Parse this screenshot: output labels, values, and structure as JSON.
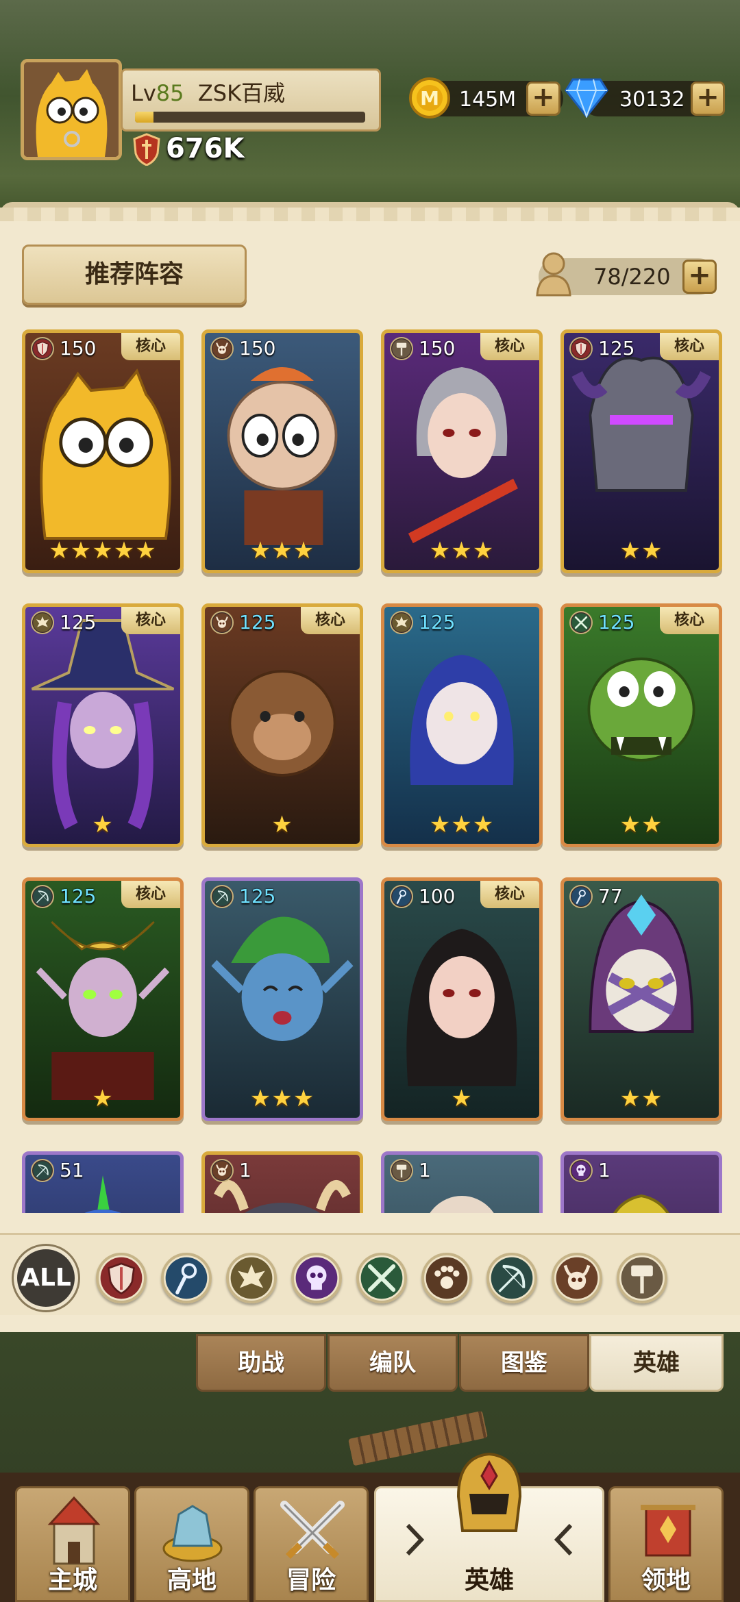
{
  "player": {
    "level_prefix": "Lv",
    "level": "85",
    "name": "ZSK百威",
    "power": "676K",
    "xp_fraction": 0.08
  },
  "resources": {
    "gold": "145M",
    "gems": "30132",
    "plus": "+"
  },
  "panel": {
    "recommend_label": "推荐阵容",
    "capacity": "78/220",
    "plus": "+"
  },
  "core_label": "核心",
  "heroes": [
    {
      "level": "150",
      "class_icon": "shield-icon",
      "core": true,
      "stars": "★★★★★",
      "rarity": "gold",
      "blue": false,
      "art": "yellow-creature"
    },
    {
      "level": "150",
      "class_icon": "horned-skull-icon",
      "core": false,
      "stars": "★★★",
      "rarity": "gold",
      "blue": false,
      "art": "pig-hero"
    },
    {
      "level": "150",
      "class_icon": "hammer-icon",
      "core": true,
      "stars": "★★★",
      "rarity": "gold",
      "blue": false,
      "art": "silver-hair-warrior"
    },
    {
      "level": "125",
      "class_icon": "shield-icon",
      "core": true,
      "stars": "★★",
      "rarity": "gold",
      "blue": false,
      "art": "dark-knight"
    },
    {
      "level": "125",
      "class_icon": "phoenix-icon",
      "core": true,
      "stars": "★",
      "rarity": "gold",
      "blue": false,
      "art": "witch"
    },
    {
      "level": "125",
      "class_icon": "horned-skull-icon",
      "core": true,
      "stars": "★",
      "rarity": "gold",
      "blue": true,
      "art": "monkey-king"
    },
    {
      "level": "125",
      "class_icon": "phoenix-icon",
      "core": false,
      "stars": "★★★",
      "rarity": "orange",
      "blue": true,
      "art": "blue-hair-girl"
    },
    {
      "level": "125",
      "class_icon": "crossed-swords-icon",
      "core": true,
      "stars": "★★",
      "rarity": "orange",
      "blue": true,
      "art": "green-orc"
    },
    {
      "level": "125",
      "class_icon": "bow-icon",
      "core": true,
      "stars": "★",
      "rarity": "orange",
      "blue": true,
      "art": "elf-queen"
    },
    {
      "level": "125",
      "class_icon": "bow-icon",
      "core": false,
      "stars": "★★★",
      "rarity": "purple",
      "blue": true,
      "art": "blue-goblin"
    },
    {
      "level": "100",
      "class_icon": "staff-icon",
      "core": true,
      "stars": "★",
      "rarity": "orange",
      "blue": false,
      "art": "dark-hair-lady"
    },
    {
      "level": "77",
      "class_icon": "staff-icon",
      "core": false,
      "stars": "★★",
      "rarity": "orange",
      "blue": false,
      "art": "skull-mage"
    },
    {
      "level": "51",
      "class_icon": "bow-icon",
      "core": false,
      "stars": "",
      "rarity": "purple",
      "blue": false,
      "art": "blue-bird"
    },
    {
      "level": "1",
      "class_icon": "horned-skull-icon",
      "core": false,
      "stars": "",
      "rarity": "gold",
      "blue": false,
      "art": "horned-beast"
    },
    {
      "level": "1",
      "class_icon": "hammer-icon",
      "core": false,
      "stars": "",
      "rarity": "purple",
      "blue": false,
      "art": "bald-monk"
    },
    {
      "level": "1",
      "class_icon": "skull-icon",
      "core": false,
      "stars": "",
      "rarity": "purple",
      "blue": false,
      "art": "yellow-hood"
    }
  ],
  "filters": {
    "all": "ALL",
    "icons": [
      "shield-icon",
      "staff-icon",
      "phoenix-icon",
      "skull-icon",
      "crossed-swords-icon",
      "paw-icon",
      "bow-icon",
      "horned-skull-icon",
      "hammer-icon"
    ]
  },
  "subtabs": [
    "助战",
    "编队",
    "图鉴",
    "英雄"
  ],
  "nav": [
    "主城",
    "高地",
    "冒险",
    "英雄",
    "领地"
  ],
  "colors": {
    "gold_border": "#d9aa3c",
    "purple_border": "#9d77c9",
    "orange_border": "#d88a45",
    "panel_bg": "#f2e8cf"
  }
}
